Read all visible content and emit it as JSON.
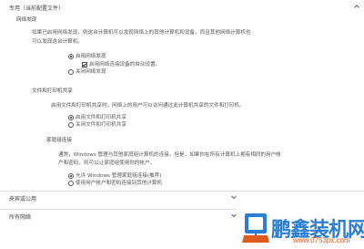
{
  "private_section": {
    "header": "专用（当前配置文件）",
    "network_discovery": {
      "title": "网络发现",
      "description_line1": "如果已启用网络发现，则这台计算机可以发现网络上的其他计算机和设备，而且其他网络计算机也",
      "description_line2": "可以发现这台计算机。",
      "option_on": "启用网络发现",
      "auto_setup": "启用网络连接设备的自动设置。",
      "option_off": "关闭网络发现"
    },
    "file_printer_sharing": {
      "title": "文件和打印机共享",
      "description": "启用文件和打印机共享时，网络上的用户可以访问通过此计算机共享的文件和打印机。",
      "option_on": "启用文件和打印机共享",
      "option_off": "关闭文件和打印机共享"
    },
    "homegroup": {
      "title": "家庭组连接",
      "description_line1": "通常，Windows 管理与其他家庭组计算机的连接。但是，如果你在所有计算机上拥有相同的用户帐",
      "description_line2": "户和密码，则可以让家庭组使用你的帐户。",
      "option_windows": "允许 Windows 管理家庭组连接(推荐)",
      "option_user": "使用用户帐户和密码连接到其他计算机"
    }
  },
  "guest_section": {
    "header": "来宾或公用"
  },
  "all_section": {
    "header": "所有网络"
  },
  "watermark": {
    "brand": "鹏鑫装机网",
    "url": "www.0753px.com"
  },
  "colors": {
    "brand_blue": "#2a7fd4",
    "url_orange": "#e05a1c"
  },
  "icons": [
    "chevron-up-icon",
    "chevron-down-icon",
    "radio-button",
    "checkbox"
  ]
}
